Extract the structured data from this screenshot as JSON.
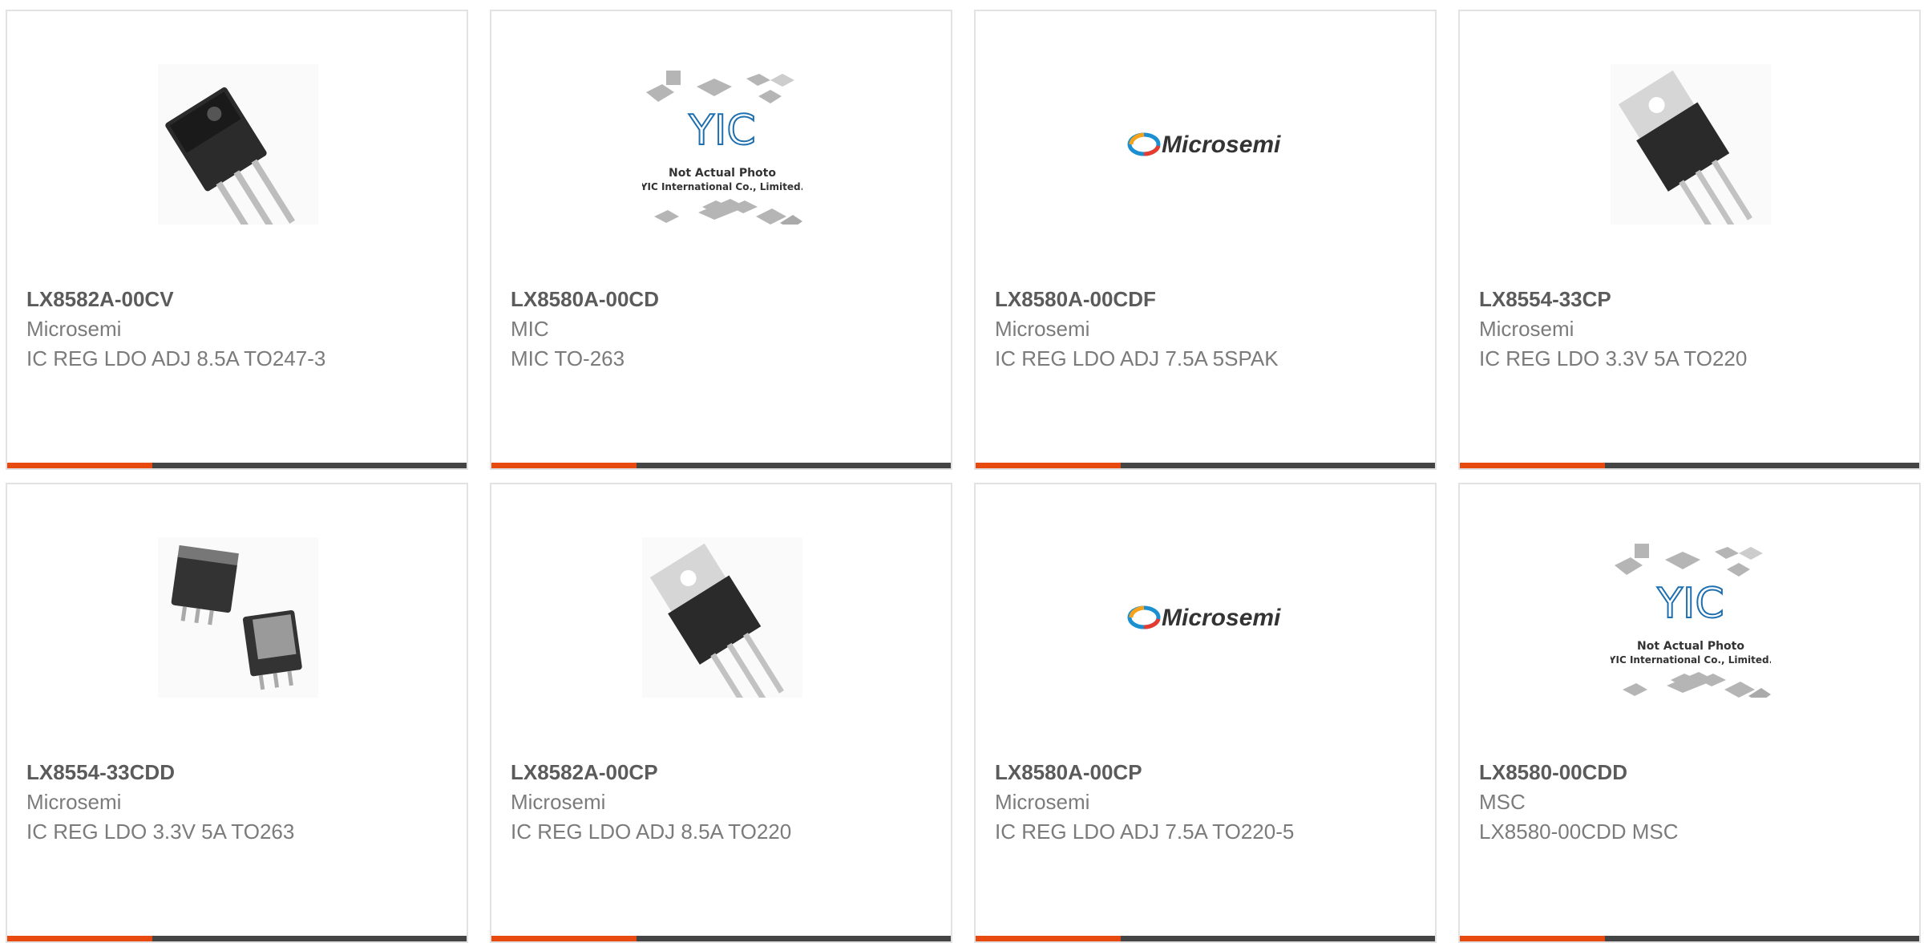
{
  "products": [
    {
      "part": "LX8582A-00CV",
      "manufacturer": "Microsemi",
      "description": "IC REG LDO ADJ 8.5A TO247-3",
      "image": "to247-photo",
      "accent_color": "#e8490f"
    },
    {
      "part": "LX8580A-00CD",
      "manufacturer": "MIC",
      "description": "MIC TO-263",
      "image": "not-actual-photo",
      "accent_color": "#e8490f",
      "placeholder": {
        "logo": "YIC",
        "line1": "Not Actual Photo",
        "line2": "YIC International Co., Limited."
      }
    },
    {
      "part": "LX8580A-00CDF",
      "manufacturer": "Microsemi",
      "description": "IC REG LDO ADJ 7.5A 5SPAK",
      "image": "microsemi-logo",
      "accent_color": "#e8490f",
      "logo_text": "Microsemi"
    },
    {
      "part": "LX8554-33CP",
      "manufacturer": "Microsemi",
      "description": "IC REG LDO 3.3V 5A TO220",
      "image": "to220-photo",
      "accent_color": "#e8490f"
    },
    {
      "part": "LX8554-33CDD",
      "manufacturer": "Microsemi",
      "description": "IC REG LDO 3.3V 5A TO263",
      "image": "to263-photo",
      "accent_color": "#e8490f"
    },
    {
      "part": "LX8582A-00CP",
      "manufacturer": "Microsemi",
      "description": "IC REG LDO ADJ 8.5A TO220",
      "image": "to220-photo",
      "accent_color": "#e8490f"
    },
    {
      "part": "LX8580A-00CP",
      "manufacturer": "Microsemi",
      "description": "IC REG LDO ADJ 7.5A TO220-5",
      "image": "microsemi-logo",
      "accent_color": "#e8490f",
      "logo_text": "Microsemi"
    },
    {
      "part": "LX8580-00CDD",
      "manufacturer": "MSC",
      "description": "LX8580-00CDD MSC",
      "image": "not-actual-photo",
      "accent_color": "#e8490f",
      "placeholder": {
        "logo": "YIC",
        "line1": "Not Actual Photo",
        "line2": "YIC International Co., Limited."
      }
    }
  ]
}
